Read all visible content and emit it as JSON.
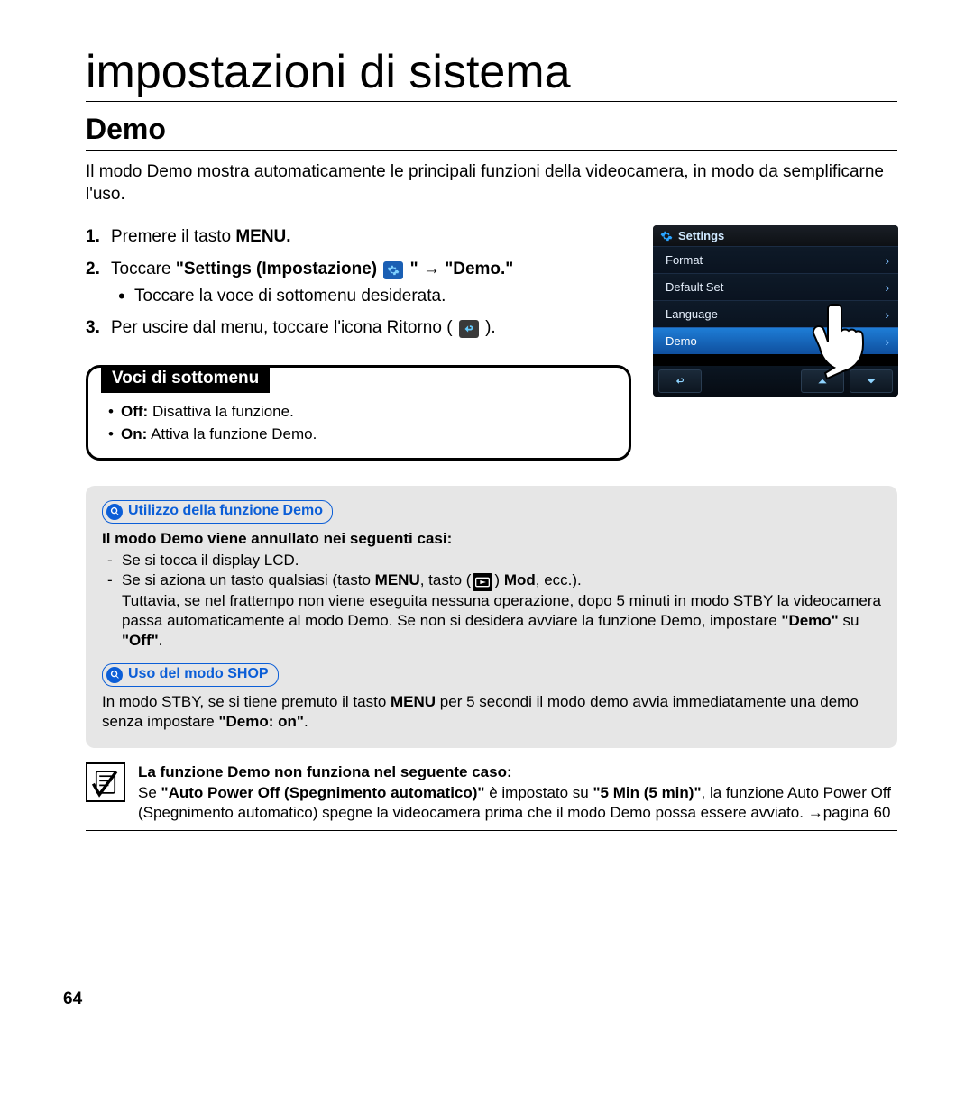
{
  "chapter_title": "impostazioni di sistema",
  "section_title": "Demo",
  "intro": "Il modo Demo mostra automaticamente le principali funzioni della videocamera, in modo da semplificarne l'uso.",
  "steps": {
    "s1_pre": "Premere il tasto ",
    "s1_bold": "MENU.",
    "s2_pre": "Toccare ",
    "s2_bold_a": "\"Settings (Impostazione) ",
    "s2_bold_b": " \" → \"Demo.\"",
    "s2_sub": "Toccare la voce di sottomenu desiderata.",
    "s3_pre": "Per uscire dal menu, toccare l'icona Ritorno ( ",
    "s3_post": " )."
  },
  "submenu": {
    "title": "Voci di sottomenu",
    "off_b": "Off:",
    "off_t": " Disattiva la funzione.",
    "on_b": "On:",
    "on_t": " Attiva la funzione Demo."
  },
  "notes": {
    "pill1": "Utilizzo della funzione Demo",
    "heading1": "Il modo Demo viene annullato nei seguenti casi:",
    "d1": "Se si tocca il display LCD.",
    "d2a": "Se si aziona un tasto qualsiasi (tasto ",
    "d2_menu": "MENU",
    "d2b": ", tasto (",
    "d2c": ") ",
    "d2_mod": "Mod",
    "d2d": ", ecc.).",
    "d2_cont1": "Tuttavia, se nel frattempo non viene eseguita nessuna operazione, dopo 5 minuti in modo STBY la videocamera passa automaticamente al modo Demo. Se non si desidera avviare la funzione Demo, impostare ",
    "d2_demo": "\"Demo\"",
    "d2_su": " su ",
    "d2_off": "\"Off\"",
    "d2_dot": ".",
    "pill2": "Uso del modo SHOP",
    "shop_a": "In modo STBY, se si tiene premuto il tasto ",
    "shop_menu": "MENU",
    "shop_b": " per 5 secondi il modo demo avvia immediatamente una demo senza impostare ",
    "shop_demo_on": "\"Demo: on\"",
    "shop_c": "."
  },
  "warn": {
    "heading": "La funzione Demo non funziona nel seguente caso:",
    "d_a": "Se ",
    "d_b": "\"Auto Power Off (Spegnimento automatico)\"",
    "d_c": " è impostato su ",
    "d_d": "\"5 Min (5 min)\"",
    "d_e": ", la funzione Auto Power Off (Spegnimento automatico) spegne la videocamera prima che il modo Demo possa essere avviato. →pagina 60"
  },
  "screen": {
    "header": "Settings",
    "items": [
      "Format",
      "Default Set",
      "Language",
      "Demo"
    ],
    "selected_index": 3
  },
  "page_number": "64"
}
